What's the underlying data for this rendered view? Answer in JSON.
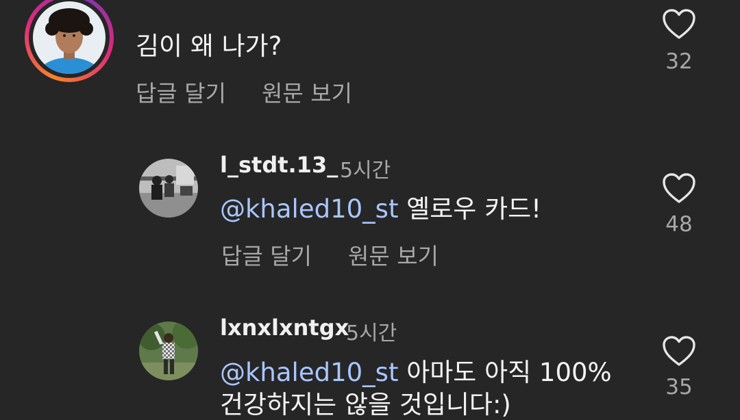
{
  "comments": [
    {
      "text": "김이 왜 나가?",
      "reply_label": "답글 달기",
      "translate_label": "원문 보기",
      "likes": "32",
      "like_icon": "heart-outline-icon",
      "has_story_ring": true
    },
    {
      "username": "l_stdt.13_",
      "time": "5시간",
      "mention": "@khaled10_st",
      "text": " 옐로우 카드!",
      "reply_label": "답글 달기",
      "translate_label": "원문 보기",
      "likes": "48",
      "like_icon": "heart-outline-icon"
    },
    {
      "username": "lxnxlxntgx",
      "time": "5시간",
      "mention": "@khaled10_st",
      "text": " 아마도 아직 100%",
      "text_line2": "건강하지는 않을 것입니다:)",
      "likes": "35",
      "like_icon": "heart-outline-icon"
    }
  ],
  "colors": {
    "background": "#262627",
    "mention": "#a9c7ff",
    "secondary_text": "#a8a8a8"
  }
}
